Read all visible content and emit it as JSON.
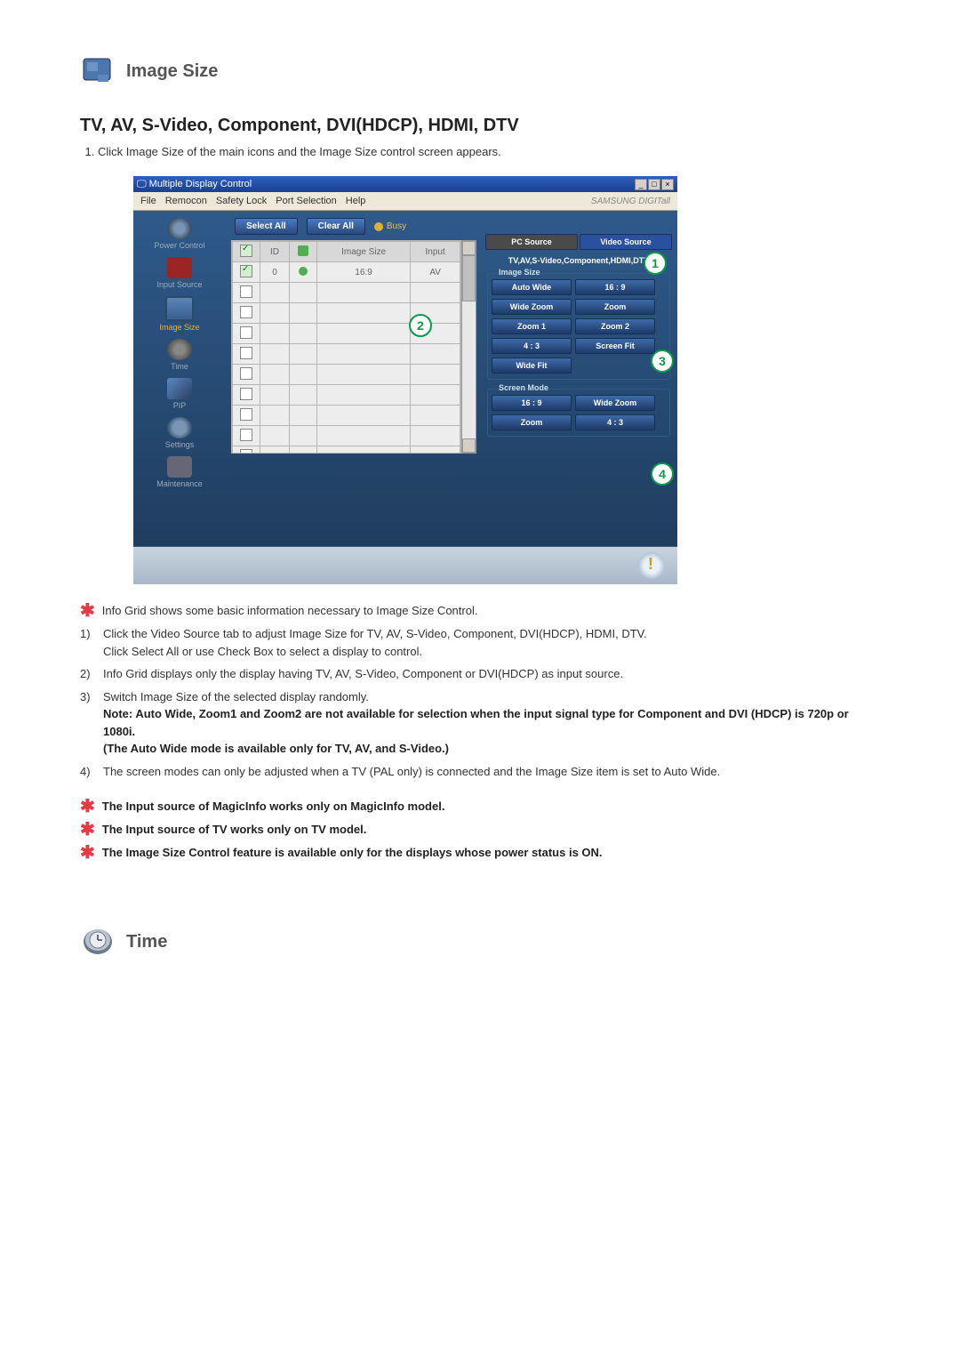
{
  "section": {
    "title": "Image Size",
    "subtitle": "TV, AV, S-Video, Component, DVI(HDCP), HDMI, DTV",
    "instruction_1": "Click Image Size of the main icons and the Image Size control screen appears."
  },
  "screenshot": {
    "window_title": "Multiple Display Control",
    "menu": [
      "File",
      "Remocon",
      "Safety Lock",
      "Port Selection",
      "Help"
    ],
    "brand": "SAMSUNG DIGITall",
    "toolbar": {
      "select_all": "Select All",
      "clear_all": "Clear All",
      "busy": "Busy"
    },
    "sidebar": [
      {
        "label": "Power Control"
      },
      {
        "label": "Input Source"
      },
      {
        "label": "Image Size",
        "selected": true
      },
      {
        "label": "Time"
      },
      {
        "label": "PIP"
      },
      {
        "label": "Settings"
      },
      {
        "label": "Maintenance"
      }
    ],
    "grid": {
      "headers": {
        "col1": "",
        "col2": "ID",
        "col3": "",
        "col4": "Image Size",
        "col5": "Input"
      },
      "row": {
        "id": "0",
        "image_size": "16:9",
        "input": "AV"
      }
    },
    "right_panel": {
      "tabs": {
        "pc": "PC Source",
        "video": "Video Source"
      },
      "video_types": "TV,AV,S-Video,Component,HDMI,DTV",
      "group_image": {
        "legend": "Image Size",
        "buttons": [
          "Auto Wide",
          "16 : 9",
          "Wide Zoom",
          "Zoom",
          "Zoom 1",
          "Zoom 2",
          "4 : 3",
          "Screen Fit",
          "Wide Fit"
        ]
      },
      "group_screen": {
        "legend": "Screen Mode",
        "buttons": [
          "16 : 9",
          "Wide Zoom",
          "Zoom",
          "4 : 3"
        ]
      }
    },
    "callouts": {
      "c1": "1",
      "c2": "2",
      "c3": "3",
      "c4": "4"
    }
  },
  "notes": {
    "star1": "Info Grid shows some basic information necessary to Image Size Control.",
    "n1a": "Click the Video Source tab to adjust Image Size for TV, AV, S-Video, Component, DVI(HDCP), HDMI, DTV.",
    "n1b": "Click Select All or use Check Box to select a display to control.",
    "n2": "Info Grid displays only the display having TV, AV, S-Video, Component or DVI(HDCP) as input source.",
    "n3a": "Switch Image Size of the selected display randomly.",
    "n3_note": "Note: Auto Wide, Zoom1 and Zoom2 are not available for selection when the input signal type for Component and DVI (HDCP) is 720p or 1080i.",
    "n3_sub": "(The Auto Wide mode is available only for TV, AV, and S-Video.)",
    "n4": "The screen modes can only be adjusted when a TV (PAL only) is connected and the Image Size item is set to Auto Wide.",
    "star2": "The Input source of MagicInfo works only on MagicInfo model.",
    "star3": "The Input source of TV works only on TV model.",
    "star4": "The Image Size Control feature is available only for the displays whose power status is ON."
  },
  "section2": {
    "title": "Time"
  }
}
